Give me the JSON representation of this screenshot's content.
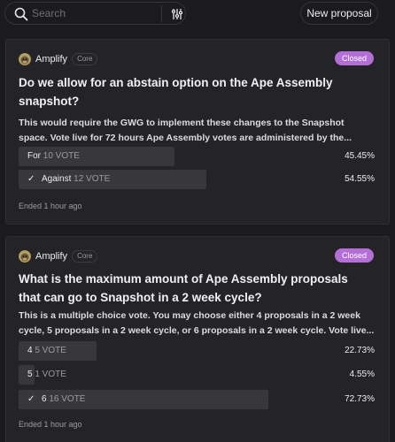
{
  "search": {
    "placeholder": "Search"
  },
  "header": {
    "new_proposal": "New proposal"
  },
  "proposals": [
    {
      "author": "Amplify",
      "badge": "Core",
      "status": "Closed",
      "title_lines": [
        "Do we allow for an abstain option on the Ape Assembly",
        "snapshot?"
      ],
      "desc_lines": [
        "This would require the GWG to implement these changes to the Snapshot",
        "space. Vote live for 72 hours Ape Assembly votes are administered by the..."
      ],
      "choices": [
        {
          "label": "For",
          "votes": "10 VOTE",
          "percent": "45.45%",
          "share": 0.4545,
          "selected": false
        },
        {
          "label": "Against",
          "votes": "12 VOTE",
          "percent": "54.55%",
          "share": 0.5455,
          "selected": true
        }
      ],
      "ended": "Ended 1 hour ago"
    },
    {
      "author": "Amplify",
      "badge": "Core",
      "status": "Closed",
      "title_lines": [
        "What is the maximum amount of Ape Assembly proposals",
        "that can go to Snapshot in a 2 week cycle?"
      ],
      "desc_lines": [
        "This is a multiple choice vote. You may choose either 4 proposals in a 2 week",
        "cycle, 5 proposals in a 2 week cycle, or 6 proposals in a 2 week cycle. Vote live..."
      ],
      "choices": [
        {
          "label": "4",
          "votes": "5 VOTE",
          "percent": "22.73%",
          "share": 0.2273,
          "selected": false
        },
        {
          "label": "5",
          "votes": "1 VOTE",
          "percent": "4.55%",
          "share": 0.0455,
          "selected": false
        },
        {
          "label": "6",
          "votes": "16 VOTE",
          "percent": "72.73%",
          "share": 0.7273,
          "selected": true
        }
      ],
      "ended": "Ended 1 hour ago"
    }
  ],
  "colors": {
    "closed_badge": "#b46fd6",
    "background": "#1b1b1e",
    "card": "#242428",
    "bar": "#38383c"
  },
  "icons": {
    "search": "search-icon",
    "filter": "sliders-icon",
    "avatar": "ape-avatar-icon",
    "check": "check-icon"
  }
}
